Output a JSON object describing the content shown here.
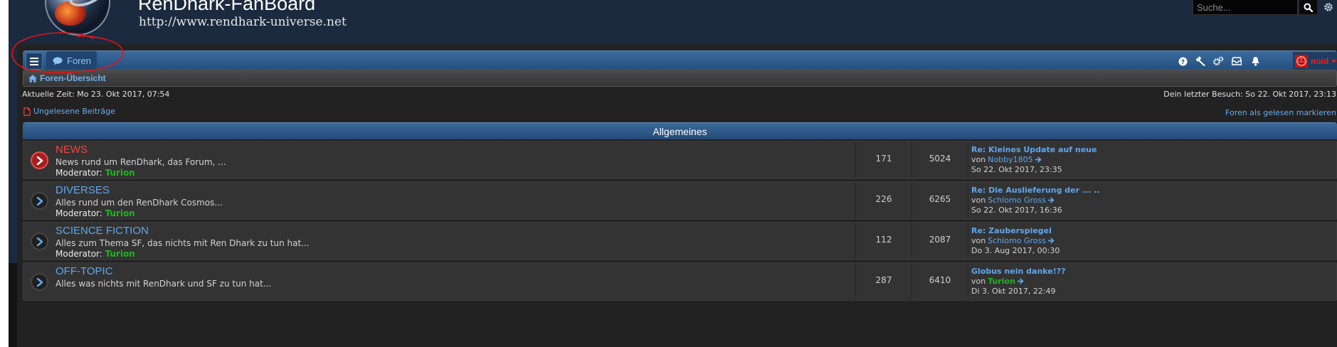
{
  "header": {
    "site_title": "RenDhark-FanBoard",
    "site_url": "http://www.rendhark-universe.net",
    "logo_icon": "planet-logo",
    "search": {
      "placeholder": "Suche...",
      "value": ""
    }
  },
  "navbar": {
    "tab_label": "Foren",
    "icons": [
      "menu-icon",
      "help-icon",
      "moderator-hammer-icon",
      "admin-gears-icon",
      "inbox-icon",
      "bell-icon"
    ],
    "user": {
      "name": "noid",
      "color": "#e02424"
    }
  },
  "breadcrumb": {
    "label": "Foren-Übersicht"
  },
  "info": {
    "current_time": "Aktuelle Zeit: Mo 23. Okt 2017, 07:54",
    "last_visit": "Dein letzter Besuch: So 22. Okt 2017, 23:13"
  },
  "links": {
    "unread": "Ungelesene Beiträge",
    "mark_read": "Foren als gelesen markieren"
  },
  "annotation": {
    "color": "#e81212",
    "shape": "hand-drawn-circle-around-unread-link"
  },
  "category": {
    "title": "Allgemeines"
  },
  "forums": [
    {
      "title": "NEWS",
      "desc": "News rund um RenDhark, das Forum, ...",
      "mod_label": "Moderator:",
      "mod_name": "Turion",
      "unread": true,
      "topics": "171",
      "posts": "5024",
      "last_title": "Re: Kleines Update auf neue F...",
      "last_by": "von",
      "last_author": "Nobby1805",
      "last_date": "So 22. Okt 2017, 23:35"
    },
    {
      "title": "DIVERSES",
      "desc": "Alles rund um den RenDhark Cosmos...",
      "mod_label": "Moderator:",
      "mod_name": "Turion",
      "unread": false,
      "topics": "226",
      "posts": "6265",
      "last_title": "Re: Die Auslieferung der ... ...",
      "last_by": "von",
      "last_author": "Schlomo Gross",
      "last_date": "So 22. Okt 2017, 16:36"
    },
    {
      "title": "SCIENCE FICTION",
      "desc": "Alles zum Thema SF, das nichts mit Ren Dhark zu tun hat...",
      "mod_label": "Moderator:",
      "mod_name": "Turion",
      "unread": false,
      "topics": "112",
      "posts": "2087",
      "last_title": "Re: Zauberspiegel",
      "last_by": "von",
      "last_author": "Schlomo Gross",
      "last_date": "Do 3. Aug 2017, 00:30"
    },
    {
      "title": "OFF-TOPIC",
      "desc": "Alles was nichts mit RenDhark und SF zu tun hat...",
      "mod_label": "",
      "mod_name": "",
      "unread": false,
      "topics": "287",
      "posts": "6410",
      "last_title": "Globus nein danke!??",
      "last_by": "von",
      "last_author": "Turion",
      "last_author_color": "#22b322",
      "last_date": "Di 3. Okt 2017, 22:49"
    }
  ],
  "colors": {
    "header_bg": "#1b2a3f",
    "content_bg": "#222222",
    "row_bg": "#333333",
    "link": "#5fa6ee",
    "unread_title": "#f04444",
    "moderator": "#22b322"
  }
}
